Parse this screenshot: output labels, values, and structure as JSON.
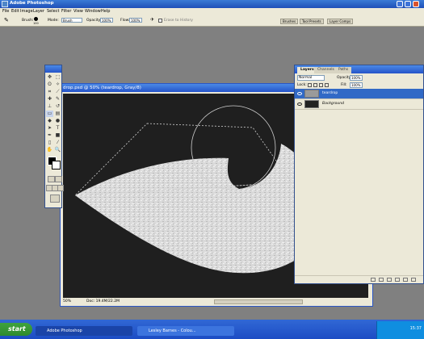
{
  "app": {
    "title": "Adobe Photoshop"
  },
  "menu": [
    "File",
    "Edit",
    "Image",
    "Layer",
    "Select",
    "Filter",
    "View",
    "Window",
    "Help"
  ],
  "options_bar": {
    "brush_label": "Brush:",
    "brush_size": "100",
    "mode_label": "Mode:",
    "mode_value": "Brush",
    "opacity_label": "Opacity:",
    "opacity_value": "100%",
    "flow_label": "Flow:",
    "flow_value": "100%",
    "erase_to_history": "Erase to History"
  },
  "palette_well": [
    "Brushes",
    "Tool Presets",
    "Layer Comps"
  ],
  "document": {
    "title": "drop.psd @ 50% (teardrop, Gray/8)",
    "zoom": "50%",
    "doc_info": "Doc: 19.4M/22.2M"
  },
  "layers_panel": {
    "tabs": [
      "Layers",
      "Channels",
      "Paths"
    ],
    "blend_mode": "Normal",
    "opacity_label": "Opacity:",
    "opacity_value": "100%",
    "lock_label": "Lock:",
    "fill_label": "Fill:",
    "fill_value": "100%",
    "layers": [
      {
        "name": "teardrop",
        "selected": true
      },
      {
        "name": "Background",
        "selected": false
      }
    ]
  },
  "taskbar": {
    "start_label": "start",
    "tasks": [
      "Adobe Photoshop",
      "Lesley Barnes - Colou..."
    ],
    "clock": "15:37"
  },
  "colors": {
    "xp_blue": "#2554c9",
    "canvas_bg": "#1f1f1f",
    "selected_layer": "#3169c6"
  }
}
